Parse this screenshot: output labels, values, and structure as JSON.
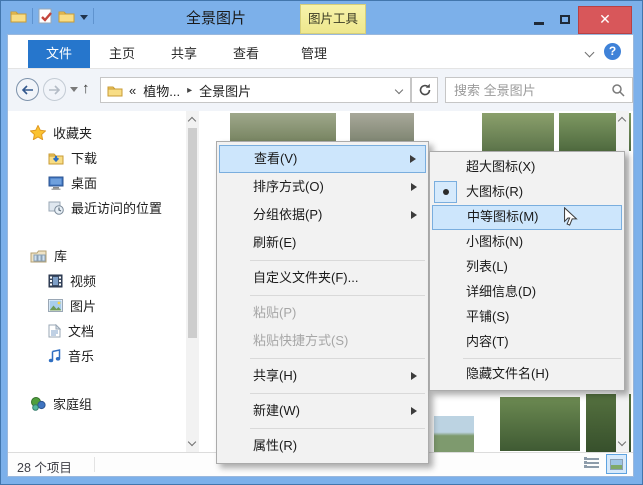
{
  "window": {
    "title": "全景图片",
    "tool_tab_label": "图片工具",
    "minimize_label": "",
    "maximize_label": "",
    "close_label": "✕"
  },
  "ribbon": {
    "file_tab": "文件",
    "home_tab": "主页",
    "share_tab": "共享",
    "view_tab": "查看",
    "manage_tab": "管理",
    "help_label": "?"
  },
  "address_bar": {
    "crumb_prefix": "«",
    "crumb_parent": "植物...",
    "crumb_separator": "▸",
    "crumb_current": "全景图片",
    "search_placeholder": "搜索 全景图片",
    "up_arrow": "↑"
  },
  "sidebar": {
    "favorites_label": "收藏夹",
    "downloads_label": "下载",
    "desktop_label": "桌面",
    "recent_label": "最近访问的位置",
    "libraries_label": "库",
    "videos_label": "视频",
    "pictures_label": "图片",
    "documents_label": "文档",
    "music_label": "音乐",
    "homegroup_label": "家庭组"
  },
  "context_menu": {
    "items": [
      {
        "label": "查看(V)",
        "submenu": true,
        "highlighted": true
      },
      {
        "label": "排序方式(O)",
        "submenu": true
      },
      {
        "label": "分组依据(P)",
        "submenu": true
      },
      {
        "label": "刷新(E)"
      },
      {
        "type": "separator"
      },
      {
        "label": "自定义文件夹(F)..."
      },
      {
        "type": "separator"
      },
      {
        "label": "粘贴(P)",
        "disabled": true
      },
      {
        "label": "粘贴快捷方式(S)",
        "disabled": true
      },
      {
        "type": "separator"
      },
      {
        "label": "共享(H)",
        "submenu": true
      },
      {
        "type": "separator"
      },
      {
        "label": "新建(W)",
        "submenu": true
      },
      {
        "type": "separator"
      },
      {
        "label": "属性(R)"
      }
    ]
  },
  "view_submenu": {
    "items": [
      {
        "label": "超大图标(X)"
      },
      {
        "label": "大图标(R)",
        "radio_selected": true
      },
      {
        "label": "中等图标(M)",
        "highlighted": true
      },
      {
        "label": "小图标(N)"
      },
      {
        "label": "列表(L)"
      },
      {
        "label": "详细信息(D)"
      },
      {
        "label": "平铺(S)"
      },
      {
        "label": "内容(T)"
      },
      {
        "type": "separator"
      },
      {
        "label": "隐藏文件名(H)"
      }
    ]
  },
  "status_bar": {
    "items_count": "28 个项目"
  },
  "colors": {
    "frame": "#7cb0ea",
    "close_button": "#d8575a",
    "file_tab": "#2676cc",
    "tool_tab": "#f2ed9d",
    "menu_highlight": "#cde6fc",
    "menu_highlight_border": "#7aaede"
  }
}
